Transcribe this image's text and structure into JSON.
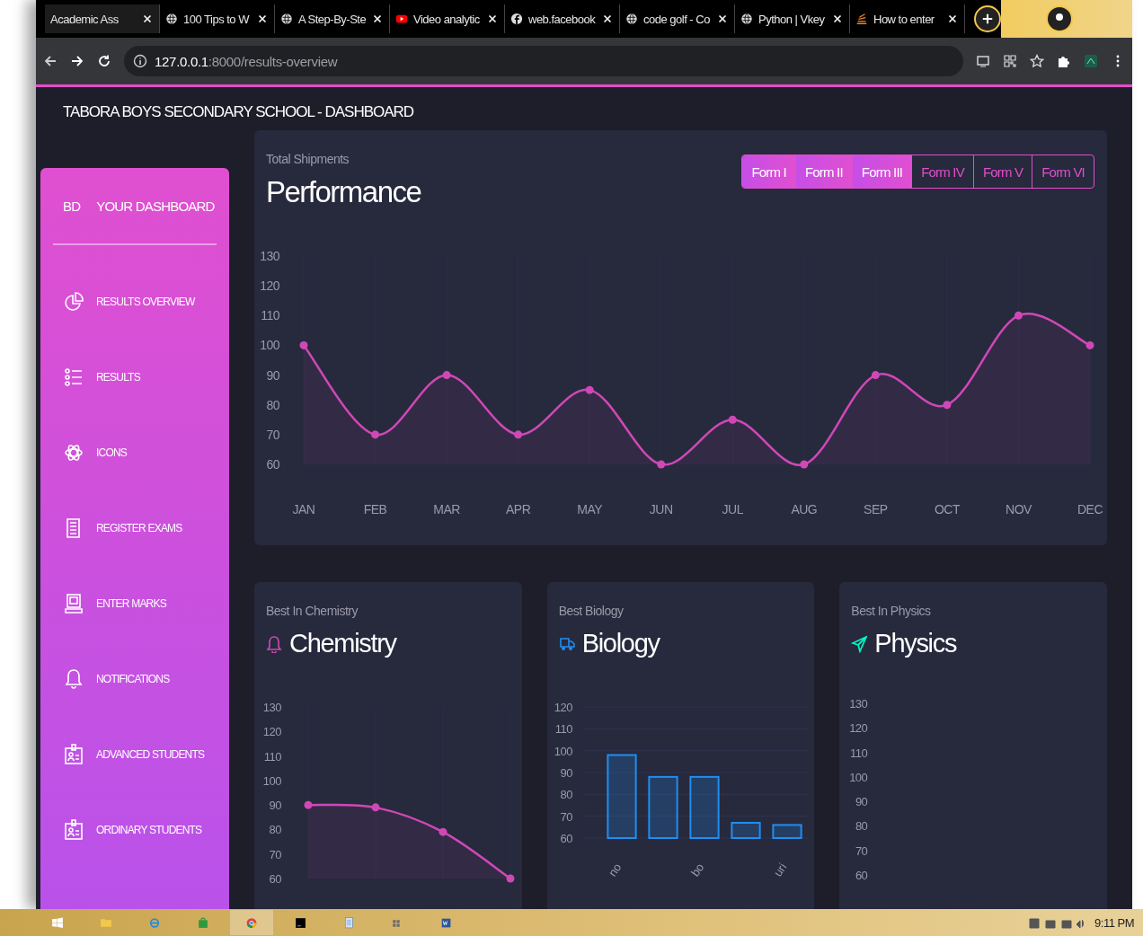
{
  "browser": {
    "tabs": [
      {
        "title": "Academic Ass",
        "kind": "none",
        "selected": true
      },
      {
        "title": "100 Tips to W",
        "kind": "globe",
        "selected": false
      },
      {
        "title": "A Step-By-Ste",
        "kind": "globe",
        "selected": false
      },
      {
        "title": "Video analytic",
        "kind": "video",
        "selected": false
      },
      {
        "title": "web.facebook",
        "kind": "facebook",
        "selected": false
      },
      {
        "title": "code golf - Co",
        "kind": "globe",
        "selected": false
      },
      {
        "title": "Python | Vkey",
        "kind": "globe",
        "selected": false
      },
      {
        "title": "How to enter",
        "kind": "stack",
        "selected": false
      }
    ],
    "url": "**127.0.0.1**:8000/results-overview"
  },
  "header": {
    "title": "TABORA BOYS SECONDARY SCHOOL - DASHBOARD"
  },
  "sidebar": {
    "logo": "BD",
    "brand": "YOUR DASHBOARD",
    "items": [
      {
        "label": "RESULTS OVERVIEW",
        "kind": "pie"
      },
      {
        "label": "RESULTS",
        "kind": "list"
      },
      {
        "label": "ICONS",
        "kind": "atom"
      },
      {
        "label": "REGISTER EXAMS",
        "kind": "paper"
      },
      {
        "label": "ENTER MARKS",
        "kind": "monitor"
      },
      {
        "label": "NOTIFICATIONS",
        "kind": "bell"
      },
      {
        "label": "ADVANCED STUDENTS",
        "kind": "badge"
      },
      {
        "label": "ORDINARY STUDENTS",
        "kind": "badge"
      }
    ]
  },
  "performance": {
    "subtitle": "Total Shipments",
    "title": "Performance",
    "forms": [
      {
        "label": "Form I",
        "selected": true
      },
      {
        "label": "Form II",
        "selected": true
      },
      {
        "label": "Form III",
        "selected": true
      },
      {
        "label": "Form IV",
        "selected": false
      },
      {
        "label": "Form V",
        "selected": false
      },
      {
        "label": "Form VI",
        "selected": false
      }
    ],
    "chart_data": {
      "type": "line",
      "categories": [
        "JAN",
        "FEB",
        "MAR",
        "APR",
        "MAY",
        "JUN",
        "JUL",
        "AUG",
        "SEP",
        "OCT",
        "NOV",
        "DEC"
      ],
      "series": [
        {
          "color": "#d048b6",
          "marker": "circle",
          "values": [
            100,
            70,
            90,
            70,
            85,
            60,
            75,
            60,
            90,
            80,
            110,
            100
          ]
        }
      ],
      "ylim": [
        60,
        130
      ],
      "yticks": [
        60,
        70,
        80,
        90,
        100,
        110,
        120,
        130
      ],
      "grid": true
    }
  },
  "cards": [
    {
      "subtitle": "Best In Chemistry",
      "title": "Chemistry",
      "kind": "bell",
      "chart_data": {
        "type": "line",
        "series": [
          {
            "color": "#d048b6",
            "marker": "circle",
            "values": [
              90,
              89,
              79,
              60
            ]
          }
        ],
        "ylim": [
          60,
          130
        ],
        "yticks": [
          60,
          70,
          80,
          90,
          100,
          110,
          120,
          130
        ],
        "grid": true
      }
    },
    {
      "subtitle": "Best Biology",
      "title": "Biology",
      "kind": "truck",
      "chart_data": {
        "type": "bar",
        "categories": [
          "no",
          null,
          "bo",
          null,
          "uri"
        ],
        "series": [
          {
            "color": "#1f8ef1",
            "values": [
              98,
              88,
              88,
              67,
              66
            ]
          }
        ],
        "ylim": [
          60,
          120
        ],
        "yticks": [
          60,
          70,
          80,
          90,
          100,
          110,
          120
        ],
        "grid": true
      }
    },
    {
      "subtitle": "Best In Physics",
      "title": "Physics",
      "kind": "plane",
      "axis_labels": [
        "130",
        "120",
        "110",
        "100",
        "90",
        "80",
        "70",
        "60"
      ]
    }
  ],
  "taskbar": {
    "clock": "9:11 PM"
  }
}
